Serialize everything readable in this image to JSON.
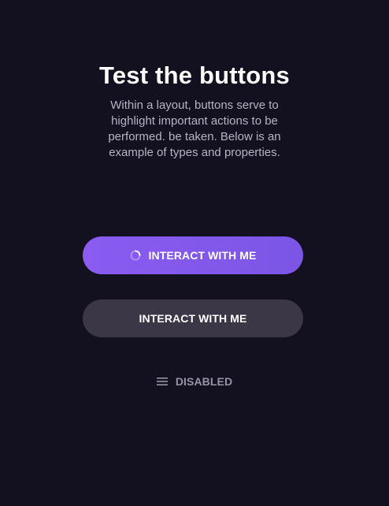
{
  "header": {
    "title": "Test the buttons",
    "description": "Within a layout, buttons serve to highlight important actions to be performed. be taken. Below is an example of types and properties."
  },
  "buttons": {
    "primary": {
      "label": "INTERACT WITH ME",
      "icon": "loading-spinner-icon",
      "color": "#8a5cf1"
    },
    "secondary": {
      "label": "INTERACT WITH ME",
      "color": "#3b3746"
    },
    "disabled": {
      "label": "DISABLED",
      "icon": "menu-lines-icon",
      "color": "#9894a7"
    }
  },
  "colors": {
    "background": "#13101f",
    "title": "#ffffff",
    "description": "#b7b3c6"
  }
}
